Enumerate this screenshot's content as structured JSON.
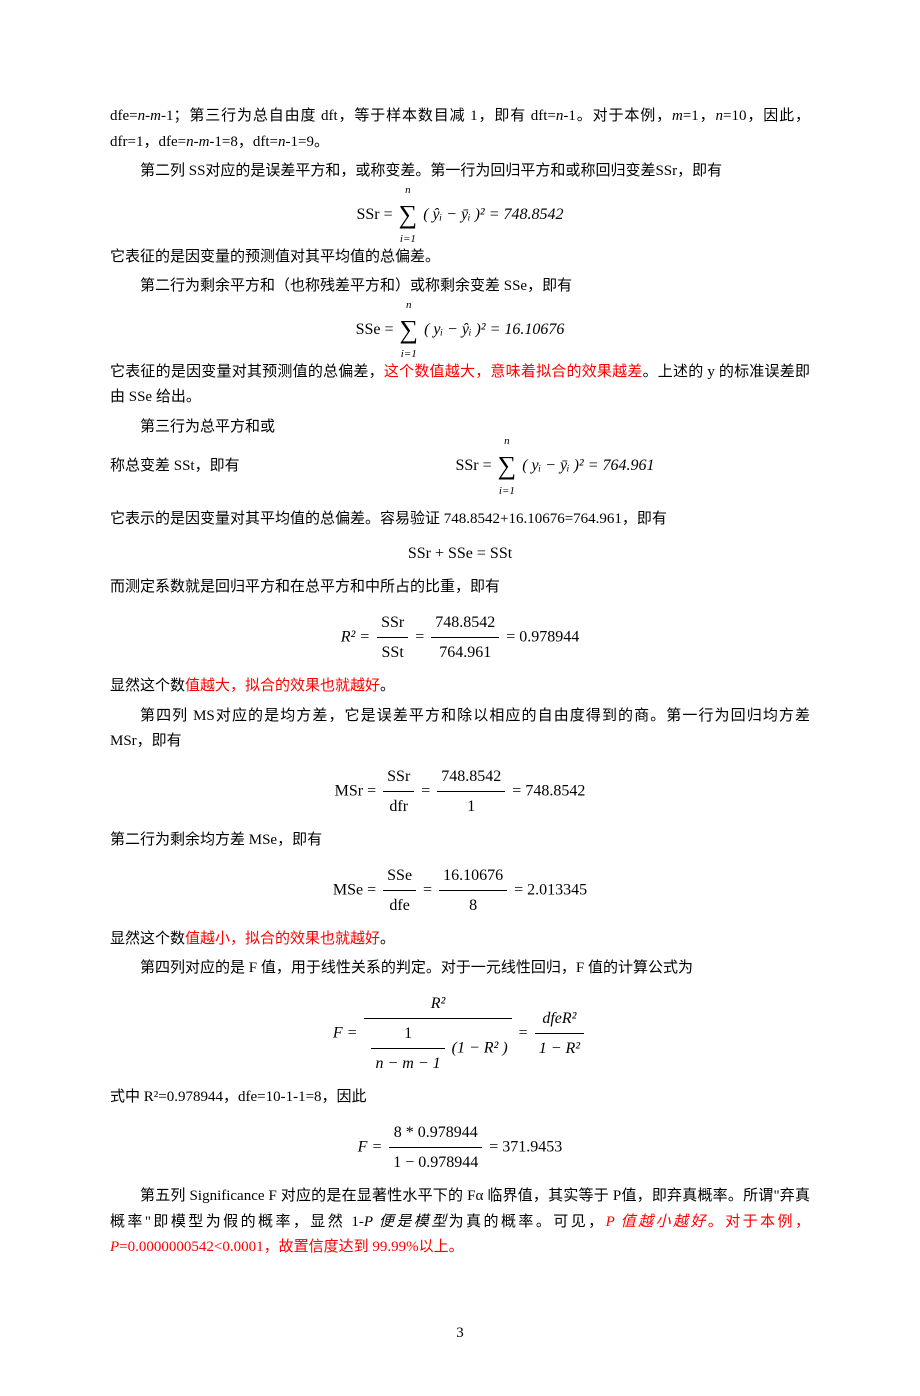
{
  "p1a": "dfe=",
  "p1b": "n",
  "p1c": "-",
  "p1d": "m",
  "p1e": "-1；第三行为总自由度 dft，等于样本数目减 1，即有 dft=",
  "p1f": "n",
  "p1g": "-1。对于本例，",
  "p1h": "m",
  "p1i": "=1，",
  "p1j": "n",
  "p1k": "=10，因此，dfr=1，dfe=",
  "p1l": "n",
  "p1m": "-",
  "p1n": "m",
  "p1o": "-1=8，dft=",
  "p1p": "n",
  "p1q": "-1=9。",
  "p2": "第二列 SS对应的是误差平方和，或称变差。第一行为回归平方和或称回归变差SSr，即有",
  "eq1": {
    "lhs": "SSr =",
    "sumTop": "n",
    "sumBot": "i=1",
    "body": "( ŷᵢ − ȳᵢ )² = 748.8542"
  },
  "p3": "它表征的是因变量的预测值对其平均值的总偏差。",
  "p4": "第二行为剩余平方和（也称残差平方和）或称剩余变差 SSe，即有",
  "eq2": {
    "lhs": "SSe =",
    "sumTop": "n",
    "sumBot": "i=1",
    "body": "( yᵢ − ŷᵢ )² = 16.10676"
  },
  "p5a": "它表征的是因变量对其预测值的总偏差，",
  "p5b": "这个数值越大，意味着拟合的效果越差",
  "p5c": "。上述的 y 的标准误差即由 SSe 给出。",
  "p6a": "第三行为总平方和或",
  "p6b": "称总变差 SSt，即有",
  "eq3": {
    "lhs": "SSr =",
    "sumTop": "n",
    "sumBot": "i=1",
    "body": "( yᵢ − ȳᵢ )² = 764.961"
  },
  "p7": "它表示的是因变量对其平均值的总偏差。容易验证 748.8542+16.10676=764.961，即有",
  "eq4": "SSr + SSe = SSt",
  "p8": "而测定系数就是回归平方和在总平方和中所占的比重，即有",
  "eq5": {
    "lhs": "R² =",
    "f1t": "SSr",
    "f1b": "SSt",
    "mid": "=",
    "f2t": "748.8542",
    "f2b": "764.961",
    "rhs": "= 0.978944"
  },
  "p9a": "显然这个数",
  "p9b": "值越大，拟合的效果也就越好",
  "p9c": "。",
  "p10": "第四列 MS对应的是均方差，它是误差平方和除以相应的自由度得到的商。第一行为回归均方差 MSr，即有",
  "eq6": {
    "lhs": "MSr =",
    "f1t": "SSr",
    "f1b": "dfr",
    "mid": "=",
    "f2t": "748.8542",
    "f2b": "1",
    "rhs": "= 748.8542"
  },
  "p11": "第二行为剩余均方差 MSe，即有",
  "eq7": {
    "lhs": "MSe =",
    "f1t": "SSe",
    "f1b": "dfe",
    "mid": "=",
    "f2t": "16.10676",
    "f2b": "8",
    "rhs": "= 2.013345"
  },
  "p12a": "显然这个数",
  "p12b": "值越小，拟合的效果也就越好",
  "p12c": "。",
  "p13": "第四列对应的是 F 值，用于线性关系的判定。对于一元线性回归，F 值的计算公式为",
  "eq8": {
    "lhs": "F =",
    "f1top": "R²",
    "f1bot_top": "1",
    "f1bot_bot": "n − m − 1",
    "f1bot_suffix": "(1 − R² )",
    "mid": "=",
    "f2t": "dfeR²",
    "f2b": "1 − R²"
  },
  "p14": "式中 R²=0.978944，dfe=10-1-1=8，因此",
  "eq9": {
    "lhs": "F =",
    "f1t": "8 * 0.978944",
    "f1b": "1 − 0.978944",
    "rhs": "= 371.9453"
  },
  "p15a": "第五列 Significance F 对应的是在显著性水平下的 Fα 临界值，其实等于 P值，即弃真概率。所谓\"弃真概率\"即模型为假的概率，显然 1-",
  "p15b": "P 便是模型",
  "p15c": "为真的概率。可见，",
  "p15d": "P 值越小越好",
  "p15e": "。对于本例，",
  "p15f": "P",
  "p15g": "=0.0000000542<0.0001，故置信度达到 99.99%以上。",
  "pageNum": "3",
  "chart_data": {
    "type": "table",
    "title": "Regression ANOVA summary values referenced in text",
    "rows": [
      {
        "name": "SSr (regression SS)",
        "value": 748.8542
      },
      {
        "name": "SSe (residual SS)",
        "value": 16.10676
      },
      {
        "name": "SSt (total SS)",
        "value": 764.961
      },
      {
        "name": "R²",
        "value": 0.978944
      },
      {
        "name": "MSr",
        "value": 748.8542
      },
      {
        "name": "MSe",
        "value": 2.013345
      },
      {
        "name": "F",
        "value": 371.9453
      },
      {
        "name": "dfr",
        "value": 1
      },
      {
        "name": "dfe",
        "value": 8
      },
      {
        "name": "dft",
        "value": 9
      },
      {
        "name": "n",
        "value": 10
      },
      {
        "name": "m",
        "value": 1
      },
      {
        "name": "P",
        "value": 5.42e-08
      }
    ]
  }
}
